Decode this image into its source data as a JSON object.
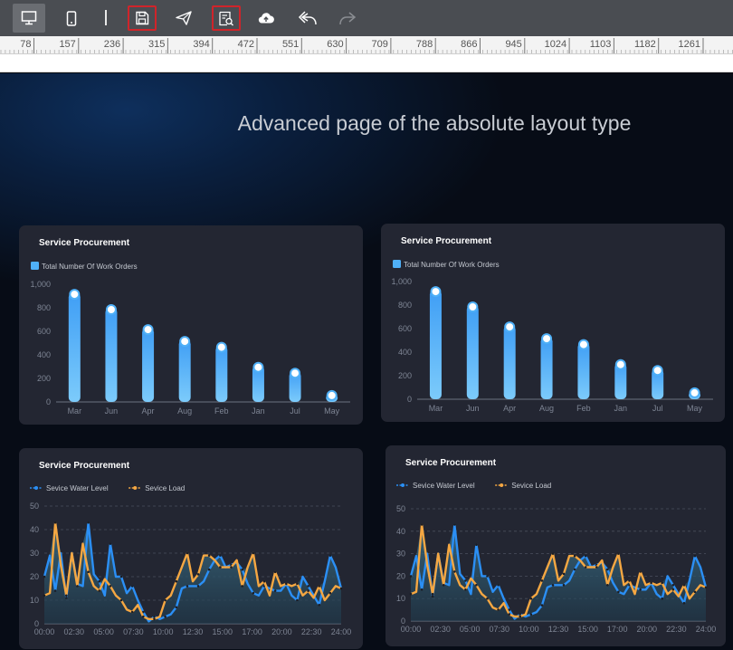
{
  "toolbar": {
    "items": [
      {
        "name": "desktop-view-icon"
      },
      {
        "name": "mobile-view-icon"
      },
      {
        "name": "save-icon"
      },
      {
        "name": "publish-send-icon"
      },
      {
        "name": "preview-icon"
      },
      {
        "name": "cloud-upload-icon"
      },
      {
        "name": "undo-icon"
      },
      {
        "name": "redo-icon"
      }
    ],
    "colors": {
      "bg": "#4a4d52",
      "highlight": "#d0242a",
      "icon": "#ffffff",
      "disabled": "#8a8d92"
    }
  },
  "ruler": {
    "labels": [
      "78",
      "157",
      "236",
      "315",
      "394",
      "472",
      "551",
      "630",
      "709",
      "788",
      "866",
      "945",
      "1024",
      "1103",
      "1182",
      "1261"
    ]
  },
  "page": {
    "title": "Advanced page of the absolute layout type"
  },
  "panels": [
    {
      "title": "Service Procurement",
      "chart": 0
    },
    {
      "title": "Service Procurement",
      "chart": 1
    },
    {
      "title": "Service Procurement",
      "chart": 2
    },
    {
      "title": "Service Procurement",
      "chart": 3
    }
  ],
  "chart_data": [
    {
      "type": "bar",
      "legend": [
        "Total Number Of Work Orders"
      ],
      "categories": [
        "Mar",
        "Jun",
        "Apr",
        "Aug",
        "Feb",
        "Jan",
        "Jul",
        "May"
      ],
      "series": [
        {
          "name": "Total Number Of Work Orders",
          "values": [
            930,
            800,
            630,
            530,
            480,
            310,
            260,
            70
          ]
        }
      ],
      "ylim": [
        0,
        1000
      ],
      "yticks": [
        "0",
        "200",
        "400",
        "600",
        "800",
        "1,000"
      ],
      "grid": false,
      "color": "#4fb0f7"
    },
    {
      "type": "bar",
      "legend": [
        "Total Number Of Work Orders"
      ],
      "categories": [
        "Mar",
        "Jun",
        "Apr",
        "Aug",
        "Feb",
        "Jan",
        "Jul",
        "May"
      ],
      "series": [
        {
          "name": "Total Number Of Work Orders",
          "values": [
            930,
            800,
            630,
            530,
            480,
            310,
            260,
            70
          ]
        }
      ],
      "ylim": [
        0,
        1000
      ],
      "yticks": [
        "0",
        "200",
        "400",
        "600",
        "800",
        "1,000"
      ],
      "grid": false,
      "color": "#4fb0f7"
    },
    {
      "type": "line",
      "legend": [
        "Sevice Water Level",
        "Sevice Load"
      ],
      "xticks": [
        "00:00",
        "02:30",
        "05:00",
        "07:30",
        "10:00",
        "12:30",
        "15:00",
        "17:00",
        "20:00",
        "22:30",
        "24:00"
      ],
      "series": [
        {
          "name": "Sevice Water Level",
          "color": "#2b8ff5",
          "values": [
            20,
            29,
            14,
            30,
            11,
            30,
            17,
            16,
            43,
            21,
            18,
            12,
            34,
            20,
            20,
            13,
            16,
            10,
            5,
            1,
            3,
            2,
            3,
            4,
            7,
            15,
            16,
            16,
            16,
            18,
            23,
            27,
            29,
            24,
            25,
            26,
            23,
            17,
            13,
            12,
            16,
            15,
            14,
            14,
            17,
            12,
            10,
            20,
            16,
            12,
            8,
            18,
            29,
            24,
            15
          ]
        },
        {
          "name": "Sevice Load",
          "color": "#f5a742",
          "values": [
            12,
            13,
            43,
            25,
            12,
            30,
            16,
            34,
            22,
            16,
            14,
            19,
            16,
            12,
            10,
            6,
            5,
            8,
            3,
            2,
            2,
            3,
            10,
            12,
            18,
            24,
            30,
            18,
            21,
            29,
            29,
            27,
            24,
            24,
            24,
            27,
            16,
            24,
            30,
            16,
            18,
            12,
            22,
            16,
            17,
            16,
            17,
            12,
            14,
            11,
            16,
            10,
            13,
            16,
            15
          ]
        }
      ],
      "ylim": [
        0,
        50
      ],
      "yticks": [
        "0",
        "10",
        "20",
        "30",
        "40",
        "50"
      ],
      "grid": true
    },
    {
      "type": "line",
      "legend": [
        "Sevice Water Level",
        "Sevice Load"
      ],
      "xticks": [
        "00:00",
        "02:30",
        "05:00",
        "07:30",
        "10:00",
        "12:30",
        "15:00",
        "17:00",
        "20:00",
        "22:30",
        "24:00"
      ],
      "series": [
        {
          "name": "Sevice Water Level",
          "color": "#2b8ff5",
          "values": [
            20,
            29,
            14,
            30,
            11,
            30,
            17,
            16,
            43,
            21,
            18,
            12,
            34,
            20,
            20,
            13,
            16,
            10,
            5,
            1,
            3,
            2,
            3,
            4,
            7,
            15,
            16,
            16,
            16,
            18,
            23,
            27,
            29,
            24,
            25,
            26,
            23,
            17,
            13,
            12,
            16,
            15,
            14,
            14,
            17,
            12,
            10,
            20,
            16,
            12,
            8,
            18,
            29,
            24,
            15
          ]
        },
        {
          "name": "Sevice Load",
          "color": "#f5a742",
          "values": [
            12,
            13,
            43,
            25,
            12,
            30,
            16,
            34,
            22,
            16,
            14,
            19,
            16,
            12,
            10,
            6,
            5,
            8,
            3,
            2,
            2,
            3,
            10,
            12,
            18,
            24,
            30,
            18,
            21,
            29,
            29,
            27,
            24,
            24,
            24,
            27,
            16,
            24,
            30,
            16,
            18,
            12,
            22,
            16,
            17,
            16,
            17,
            12,
            14,
            11,
            16,
            10,
            13,
            16,
            15
          ]
        }
      ],
      "ylim": [
        0,
        50
      ],
      "yticks": [
        "0",
        "10",
        "20",
        "30",
        "40",
        "50"
      ],
      "grid": true
    }
  ]
}
